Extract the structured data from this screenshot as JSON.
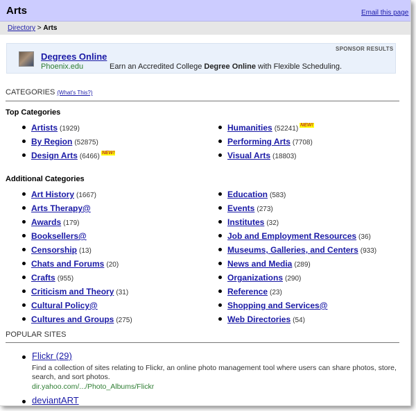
{
  "header": {
    "title": "Arts",
    "email_link": "Email this page"
  },
  "breadcrumb": {
    "directory": "Directory",
    "separator": ">",
    "current": "Arts"
  },
  "sponsor": {
    "label": "SPONSOR RESULTS",
    "title": "Degrees Online",
    "url": "Phoenix.edu",
    "desc_prefix": "Earn an Accredited College ",
    "desc_bold": "Degree Online",
    "desc_suffix": " with Flexible Scheduling."
  },
  "categories_section": {
    "heading": "CATEGORIES",
    "whats_this": "(What's This?)",
    "new_badge": "NEW!",
    "top_heading": "Top Categories",
    "top": [
      {
        "name": "Artists",
        "count": "(1929)",
        "new": false
      },
      {
        "name": "By Region",
        "count": "(52875)",
        "new": false
      },
      {
        "name": "Design Arts",
        "count": "(6466)",
        "new": true
      },
      {
        "name": "Humanities",
        "count": "(52241)",
        "new": true
      },
      {
        "name": "Performing Arts",
        "count": "(7708)",
        "new": false
      },
      {
        "name": "Visual Arts",
        "count": "(18803)",
        "new": false
      }
    ],
    "additional_heading": "Additional Categories",
    "additional": [
      {
        "name": "Art History",
        "count": "(1667)"
      },
      {
        "name": "Arts Therapy@",
        "count": ""
      },
      {
        "name": "Awards",
        "count": "(179)"
      },
      {
        "name": "Booksellers@",
        "count": ""
      },
      {
        "name": "Censorship",
        "count": "(13)"
      },
      {
        "name": "Chats and Forums",
        "count": "(20)"
      },
      {
        "name": "Crafts",
        "count": "(955)"
      },
      {
        "name": "Criticism and Theory",
        "count": "(31)"
      },
      {
        "name": "Cultural Policy@",
        "count": ""
      },
      {
        "name": "Cultures and Groups",
        "count": "(275)"
      },
      {
        "name": "Education",
        "count": "(583)"
      },
      {
        "name": "Events",
        "count": "(273)"
      },
      {
        "name": "Institutes",
        "count": "(32)"
      },
      {
        "name": "Job and Employment Resources",
        "count": "(36)"
      },
      {
        "name": "Museums, Galleries, and Centers",
        "count": "(933)"
      },
      {
        "name": "News and Media",
        "count": "(289)"
      },
      {
        "name": "Organizations",
        "count": "(290)"
      },
      {
        "name": "Reference",
        "count": "(23)"
      },
      {
        "name": "Shopping and Services@",
        "count": ""
      },
      {
        "name": "Web Directories",
        "count": "(54)"
      }
    ]
  },
  "popular_sites": {
    "heading": "POPULAR SITES",
    "sites": [
      {
        "name": "Flickr",
        "count": "(29)",
        "desc": "Find a collection of sites relating to Flickr, an online photo management tool where users can share photos, store, search, and sort photos.",
        "url": "dir.yahoo.com/.../Photo_Albums/Flickr"
      },
      {
        "name": "deviantART",
        "count": "",
        "desc": "",
        "url": ""
      }
    ]
  },
  "colors": {
    "header_bg": "#ccccff",
    "link": "#1a1aa6",
    "url_green": "#2e7d32",
    "new_badge_bg": "#ffff00"
  }
}
